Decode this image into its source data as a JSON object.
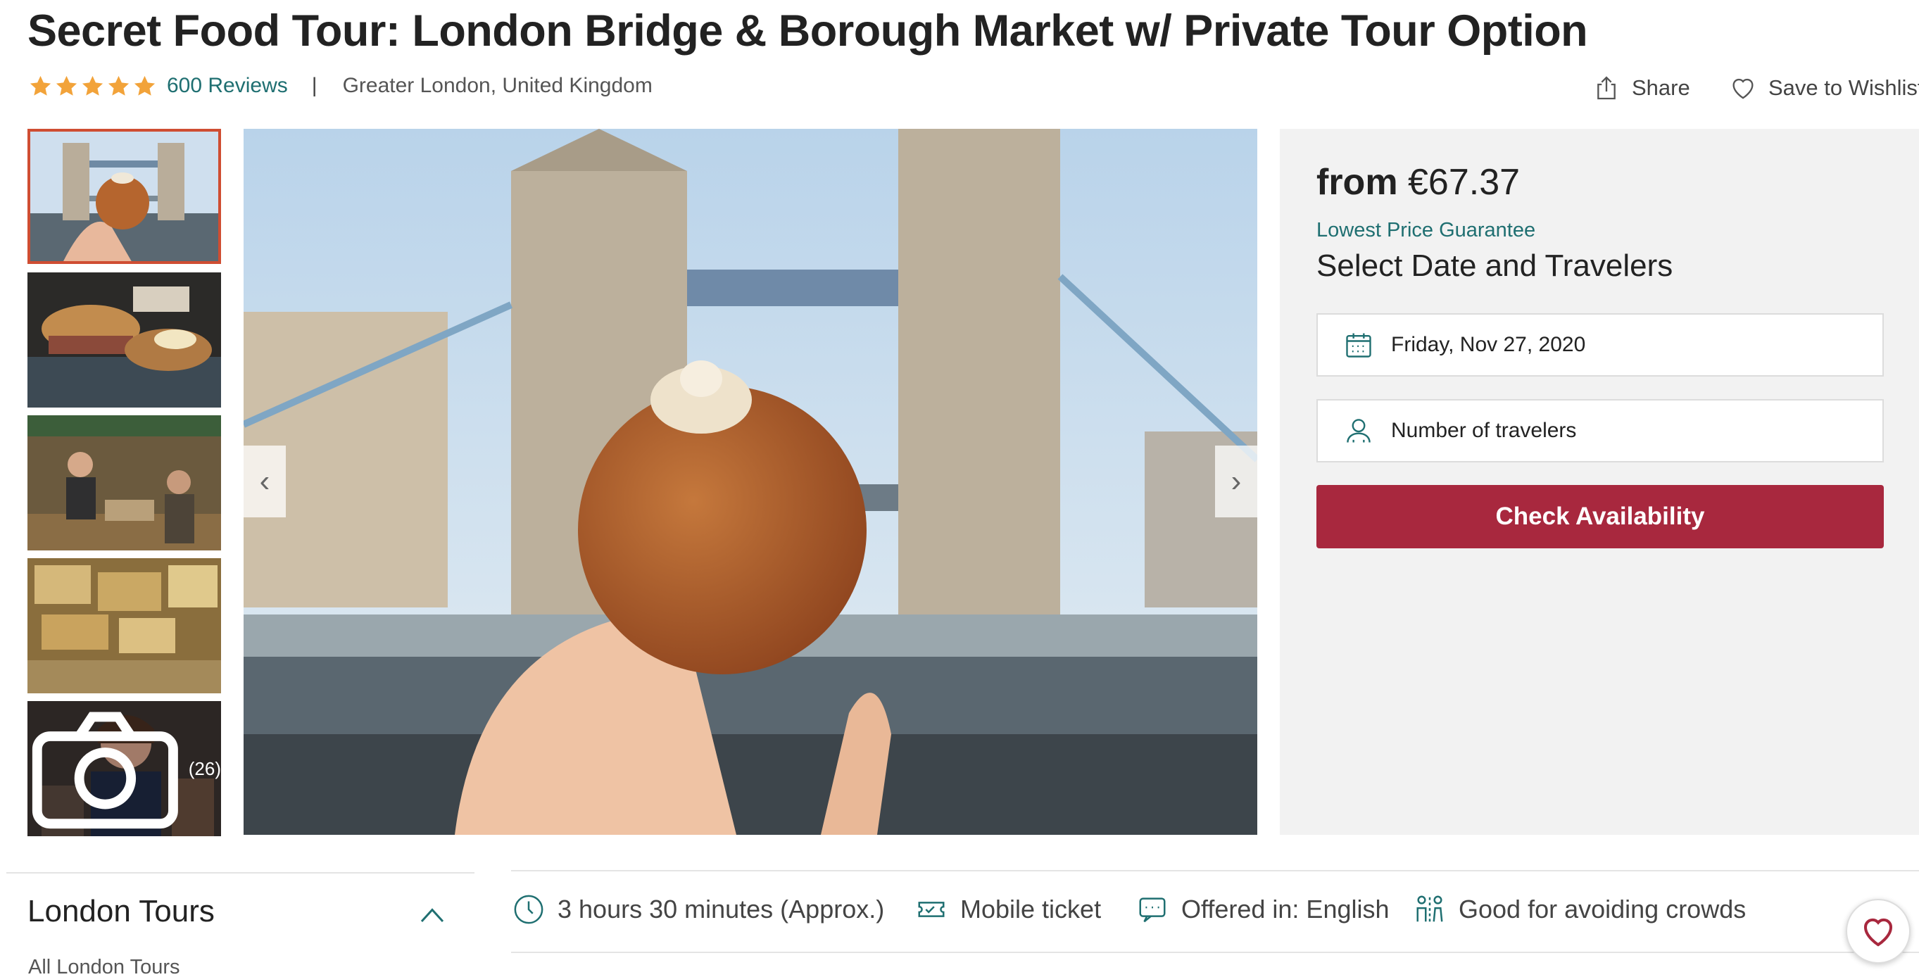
{
  "header": {
    "title": "Secret Food Tour: London Bridge & Borough Market w/ Private Tour Option",
    "rating_stars": 5,
    "reviews_label": "600 Reviews",
    "separator": "|",
    "location": "Greater London, United Kingdom",
    "share_label": "Share",
    "wishlist_label": "Save to Wishlist"
  },
  "gallery": {
    "thumbnails": [
      {
        "subject": "tower-bridge-doughnut"
      },
      {
        "subject": "market-sandwich"
      },
      {
        "subject": "market-stall-vendor"
      },
      {
        "subject": "cheese-wheels"
      },
      {
        "subject": "guide-smiling"
      }
    ],
    "photo_count_label": "(26)",
    "prev_label": "‹",
    "next_label": "›"
  },
  "booking": {
    "price_prefix": "from",
    "price": "€67.37",
    "guarantee": "Lowest Price Guarantee",
    "section_title": "Select Date and Travelers",
    "date_value": "Friday, Nov 27, 2020",
    "travelers_placeholder": "Number of travelers",
    "cta_label": "Check Availability"
  },
  "sidebar": {
    "title": "London Tours",
    "link": "All London Tours"
  },
  "features": [
    {
      "icon": "clock-icon",
      "label": "3 hours 30 minutes (Approx.)"
    },
    {
      "icon": "ticket-icon",
      "label": "Mobile ticket"
    },
    {
      "icon": "chat-icon",
      "label": "Offered in: English"
    },
    {
      "icon": "people-distance-icon",
      "label": "Good for avoiding crowds"
    }
  ],
  "colors": {
    "accent": "#a8283e",
    "link": "#1f6f71",
    "star": "#f2a33a",
    "thumb_active_border": "#cf4d32"
  }
}
